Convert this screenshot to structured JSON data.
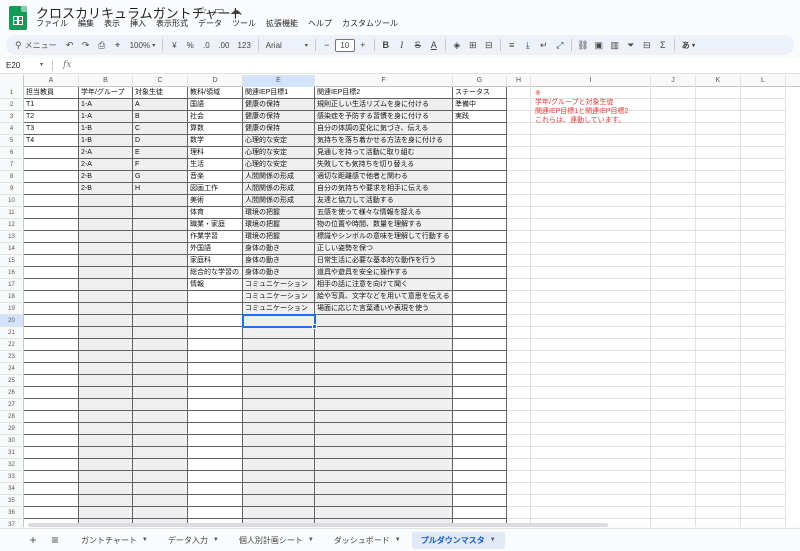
{
  "window": {
    "title": "クロスカリキュラムガントチャート",
    "menus": [
      "ファイル",
      "編集",
      "表示",
      "挿入",
      "表示形式",
      "データ",
      "ツール",
      "拡張機能",
      "ヘルプ",
      "カスタムツール"
    ]
  },
  "toolbar": {
    "search_label": "メニュー",
    "zoom": "100%",
    "currency": "¥",
    "percent": "%",
    "decimal_decrease": ".0",
    "decimal_increase": ".00",
    "number_format": "123",
    "font": "Arial",
    "font_size": "10",
    "bold": "B",
    "italic": "I",
    "text_color": "A",
    "input_tools": "あ"
  },
  "formula_bar": {
    "name_box": "E20",
    "fx": "fx",
    "value": ""
  },
  "grid": {
    "columns": [
      "A",
      "B",
      "C",
      "D",
      "E",
      "F",
      "G",
      "H",
      "I",
      "J",
      "K",
      "L"
    ],
    "row_numbers": [
      "1",
      "2",
      "3",
      "4",
      "5",
      "6",
      "7",
      "8",
      "9",
      "10",
      "11",
      "12",
      "13",
      "14",
      "15",
      "16",
      "17",
      "18",
      "19",
      "20",
      "21",
      "22",
      "23",
      "24",
      "25",
      "26",
      "27",
      "28",
      "29",
      "30",
      "31",
      "32",
      "33",
      "34",
      "35",
      "36",
      "37",
      "38"
    ],
    "header_row": [
      "担当教員",
      "学年/グループ",
      "対象生徒",
      "教科/領域",
      "関連IEP目標1",
      "関連IEP目標2",
      "ステータス"
    ],
    "rows": [
      [
        "T1",
        "1-A",
        "A",
        "国語",
        "健康の保持",
        "規則正しい生活リズムを身に付ける",
        "準備中"
      ],
      [
        "T2",
        "1-A",
        "B",
        "社会",
        "健康の保持",
        "感染症を予防する習慣を身に付ける",
        "実践"
      ],
      [
        "T3",
        "1-B",
        "C",
        "算数",
        "健康の保持",
        "自分の体調の変化に気づき、伝える",
        ""
      ],
      [
        "T4",
        "1-B",
        "D",
        "数学",
        "心理的な安定",
        "気持ちを落ち着かせる方法を身に付ける",
        ""
      ],
      [
        "",
        "2-A",
        "E",
        "理科",
        "心理的な安定",
        "見通しを持って活動に取り組む",
        ""
      ],
      [
        "",
        "2-A",
        "F",
        "生活",
        "心理的な安定",
        "失敗しても気持ちを切り替える",
        ""
      ],
      [
        "",
        "2-B",
        "G",
        "音楽",
        "人間関係の形成",
        "適切な距離感で他者と関わる",
        ""
      ],
      [
        "",
        "2-B",
        "H",
        "図画工作",
        "人間関係の形成",
        "自分の気持ちや要求を相手に伝える",
        ""
      ],
      [
        "",
        "",
        "",
        "美術",
        "人間関係の形成",
        "友達と協力して活動する",
        ""
      ],
      [
        "",
        "",
        "",
        "体育",
        "環境の把握",
        "五感を使って様々な情報を捉える",
        ""
      ],
      [
        "",
        "",
        "",
        "職業・家庭",
        "環境の把握",
        "物の位置や時間、数量を理解する",
        ""
      ],
      [
        "",
        "",
        "",
        "作業学習",
        "環境の把握",
        "標識やシンボルの意味を理解して行動する",
        ""
      ],
      [
        "",
        "",
        "",
        "外国語",
        "身体の動き",
        "正しい姿勢を保つ",
        ""
      ],
      [
        "",
        "",
        "",
        "家庭科",
        "身体の動き",
        "日常生活に必要な基本的な動作を行う",
        ""
      ],
      [
        "",
        "",
        "",
        "総合的な学習の",
        "身体の動き",
        "道具や遊具を安全に操作する",
        ""
      ],
      [
        "",
        "",
        "",
        "情報",
        "コミュニケーション",
        "相手の話に注意を向けて聞く",
        ""
      ],
      [
        "",
        "",
        "",
        "",
        "コミュニケーション",
        "絵や写真、文字などを用いて意思を伝える",
        ""
      ],
      [
        "",
        "",
        "",
        "",
        "コミュニケーション",
        "場面に応じた言葉遣いや表現を使う",
        ""
      ]
    ],
    "note_lines": [
      "※",
      "学年/グループと対象生徒",
      "関連IEP目標1と関連IEP目標2",
      "これらは、連動しています。"
    ],
    "note_color": "#e53935",
    "selected_cell": "E20"
  },
  "tabs": {
    "add_icon": "plus-icon",
    "list_icon": "menu-icon",
    "items": [
      {
        "label": "ガントチャート",
        "active": false
      },
      {
        "label": "データ入力",
        "active": false
      },
      {
        "label": "個人別計画シート",
        "active": false
      },
      {
        "label": "ダッシュボード",
        "active": false
      },
      {
        "label": "プルダウンマスタ",
        "active": true
      }
    ],
    "active_color": "#0b57d0"
  }
}
